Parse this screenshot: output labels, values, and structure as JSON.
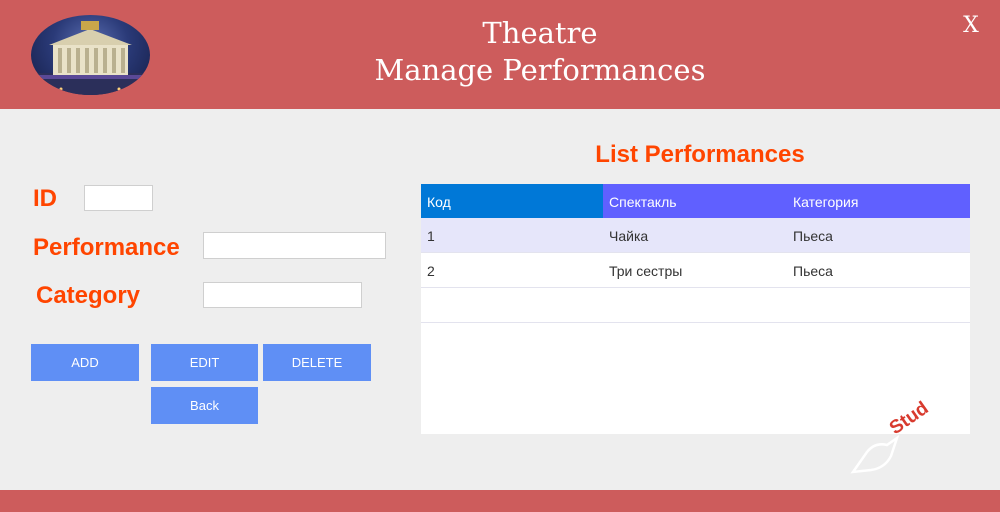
{
  "header": {
    "title_line1": "Theatre",
    "title_line2": "Manage Performances",
    "close_label": "X",
    "logo_icon": "theatre-building-icon"
  },
  "form": {
    "id_label": "ID",
    "performance_label": "Performance",
    "category_label": "Category",
    "id_value": "",
    "performance_value": "",
    "category_value": ""
  },
  "buttons": {
    "add": "ADD",
    "edit": "EDIT",
    "delete": "DELETE",
    "back": "Back"
  },
  "list": {
    "title": "List Performances",
    "columns": [
      "Код",
      "Спектакль",
      "Категория"
    ],
    "rows": [
      [
        "1",
        "Чайка",
        "Пьеса"
      ],
      [
        "2",
        "Три сестры",
        "Пьеса"
      ]
    ]
  },
  "watermark": {
    "text": "Stud"
  },
  "colors": {
    "header": "#cd5c5c",
    "label": "#ff4500",
    "button": "#5f8ff5",
    "grid_header_first": "#0078d7",
    "grid_header": "#6060ff",
    "row_selected": "#e6e6fa"
  }
}
